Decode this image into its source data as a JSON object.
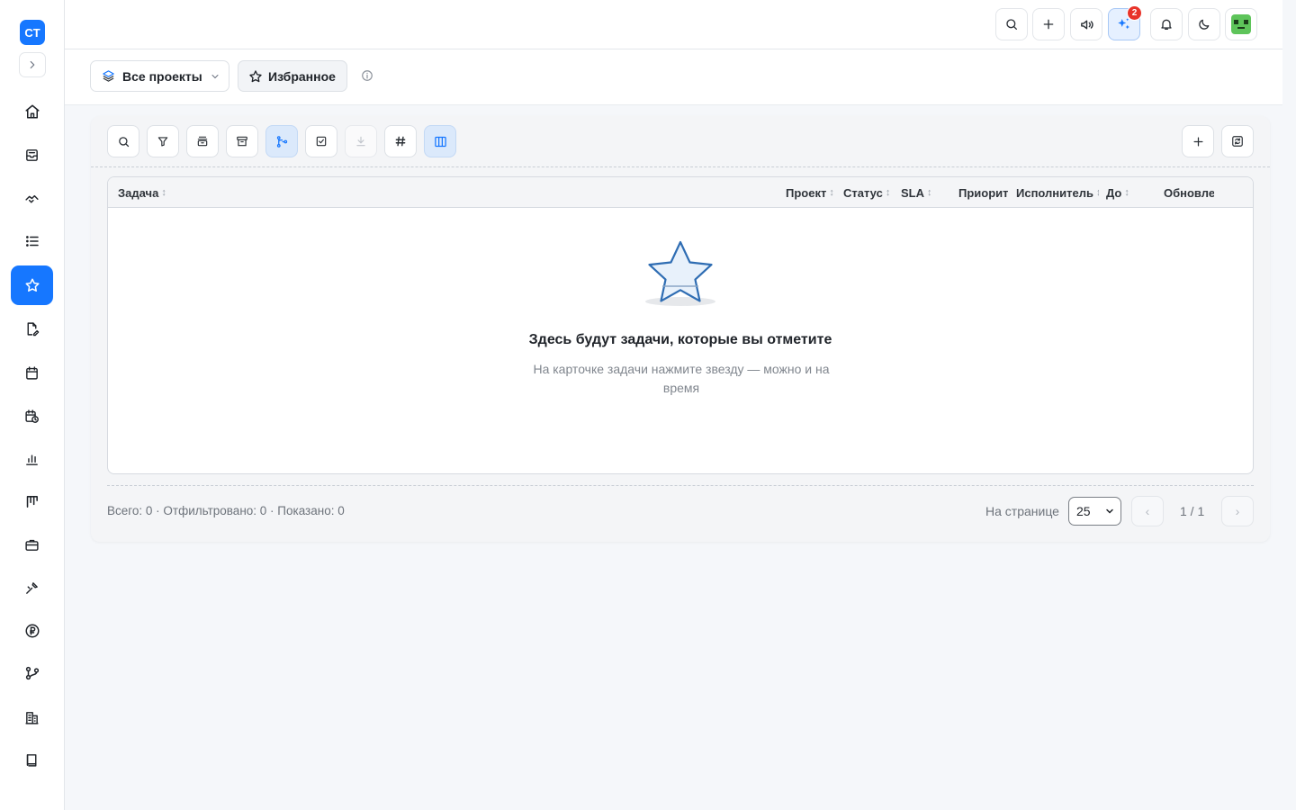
{
  "sidebar": {
    "logo": "CT",
    "items": [
      {
        "name": "home-icon"
      },
      {
        "name": "inbox-icon"
      },
      {
        "name": "handshake-icon"
      },
      {
        "name": "list-icon"
      },
      {
        "name": "star-icon",
        "active": true
      },
      {
        "name": "document-edit-icon"
      },
      {
        "name": "calendar-icon"
      },
      {
        "name": "calendar-clock-icon"
      },
      {
        "name": "bar-chart-icon"
      },
      {
        "name": "kanban-icon"
      },
      {
        "name": "briefcase-icon"
      },
      {
        "name": "tools-icon"
      },
      {
        "name": "ruble-icon"
      },
      {
        "name": "git-branch-icon"
      },
      {
        "name": "building-icon"
      },
      {
        "name": "book-icon"
      }
    ]
  },
  "topbar": {
    "ai_badge": "2",
    "icons": [
      "search-icon",
      "plus-icon",
      "announce-icon",
      "sparkles-icon",
      "bell-icon",
      "moon-icon",
      "avatar"
    ]
  },
  "filters": {
    "projects_label": "Все проекты",
    "favorites_label": "Избранное"
  },
  "table": {
    "columns": [
      {
        "label": "Задача",
        "sortable": true
      },
      {
        "label": "Проект",
        "sortable": true
      },
      {
        "label": "Статус",
        "sortable": true
      },
      {
        "label": "SLA",
        "sortable": true
      },
      {
        "label": "Приорит",
        "sortable": false
      },
      {
        "label": "Исполнитель",
        "sortable": true
      },
      {
        "label": "До",
        "sortable": true
      },
      {
        "label": "Обновле",
        "sortable": false
      }
    ],
    "rows": []
  },
  "empty_state": {
    "title": "Здесь будут задачи, которые вы отметите",
    "subtitle": "На карточке задачи нажмите звезду — можно и на время"
  },
  "footer": {
    "summary": "Всего: 0 · Отфильтровано: 0 · Показано: 0",
    "per_page_label": "На странице",
    "per_page_value": "25",
    "prev": "‹",
    "next": "›",
    "page_indicator": "1 / 1"
  },
  "colors": {
    "accent": "#1677ff",
    "badge": "#e8332a",
    "star_fill": "#e8f1fb",
    "star_stroke": "#2f6db3"
  }
}
